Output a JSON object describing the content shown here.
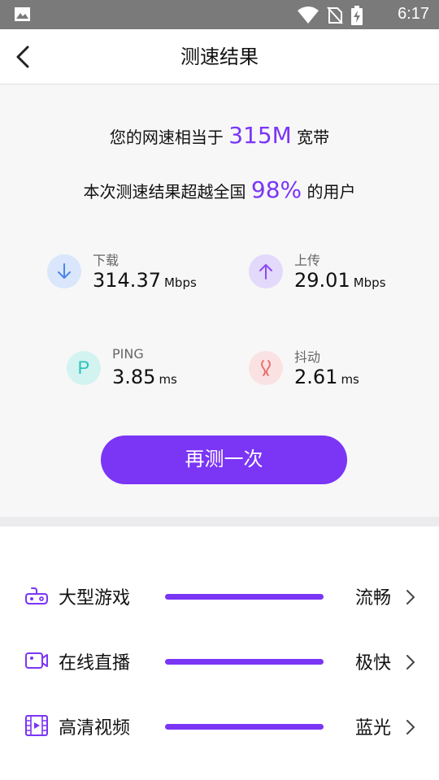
{
  "status_bar": {
    "time": "6:17"
  },
  "header": {
    "title": "测速结果"
  },
  "summary": {
    "line1_prefix": "您的网速相当于",
    "bandwidth": "315M",
    "line1_suffix": "宽带",
    "line2_prefix": "本次测速结果超越全国",
    "percentile": "98%",
    "line2_suffix": "的用户"
  },
  "metrics": {
    "download": {
      "label": "下载",
      "value": "314.37",
      "unit": "Mbps",
      "icon": "download-arrow-icon"
    },
    "upload": {
      "label": "上传",
      "value": "29.01",
      "unit": "Mbps",
      "icon": "upload-arrow-icon"
    },
    "ping": {
      "label": "PING",
      "value": "3.85",
      "unit": "ms",
      "icon_letter": "P"
    },
    "jitter": {
      "label": "抖动",
      "value": "2.61",
      "unit": "ms",
      "icon": "jitter-wave-icon"
    }
  },
  "retest_button": {
    "label": "再测一次"
  },
  "usage_list": [
    {
      "name": "大型游戏",
      "grade": "流畅",
      "icon": "gamepad-icon"
    },
    {
      "name": "在线直播",
      "grade": "极快",
      "icon": "video-camera-icon"
    },
    {
      "name": "高清视频",
      "grade": "蓝光",
      "icon": "film-icon"
    }
  ],
  "colors": {
    "accent": "#7b35f5",
    "download": "#4a84e8",
    "upload": "#8a4cf0",
    "ping": "#26c2bb",
    "jitter": "#e86a6a"
  }
}
